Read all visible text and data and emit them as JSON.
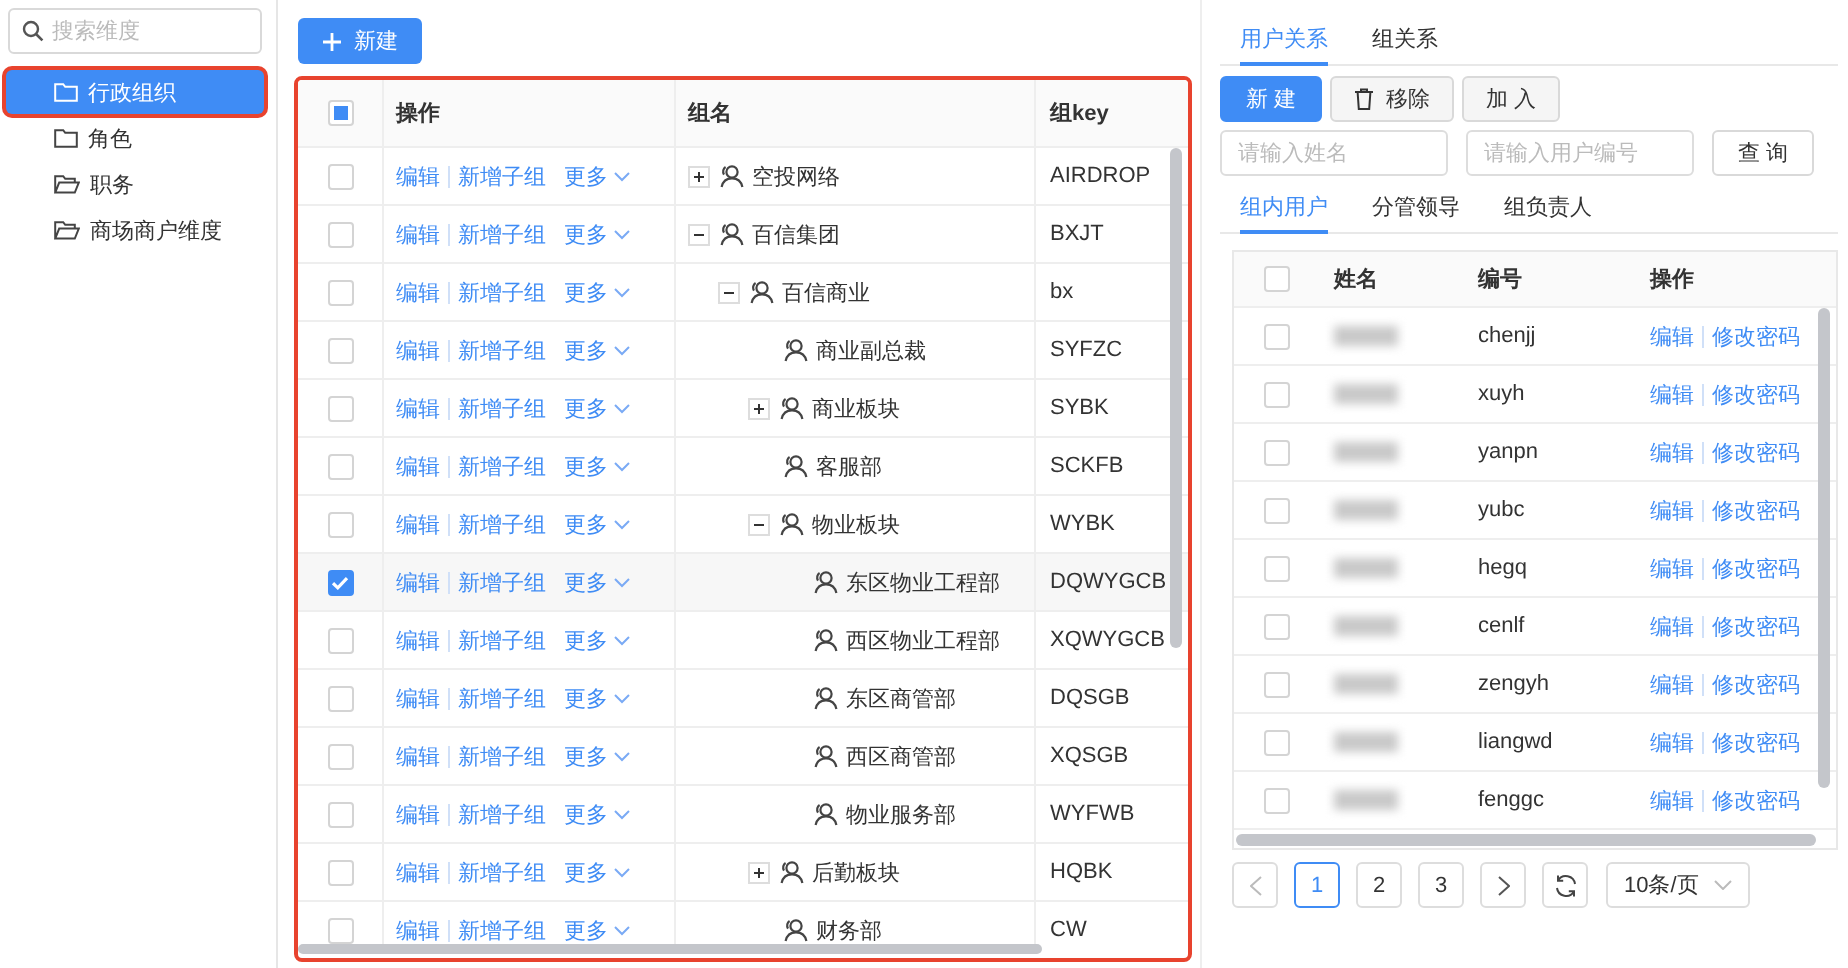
{
  "sidebar": {
    "search": {
      "placeholder": "搜索维度"
    },
    "items": [
      {
        "label": "行政组织",
        "kind": "folder",
        "selected": true,
        "highlighted": true
      },
      {
        "label": "角色",
        "kind": "folder",
        "selected": false,
        "highlighted": false
      },
      {
        "label": "职务",
        "kind": "folder-open",
        "selected": false,
        "highlighted": false
      },
      {
        "label": "商场商户维度",
        "kind": "folder-open",
        "selected": false,
        "highlighted": false
      }
    ]
  },
  "toolbar": {
    "new_button": "新建"
  },
  "group_table": {
    "highlighted": true,
    "select_all": {
      "checked": false,
      "indeterminate": true
    },
    "columns": [
      "操作",
      "组名",
      "组key"
    ],
    "rows": [
      {
        "checked": false,
        "actions": [
          "编辑",
          "新增子组",
          "更多"
        ],
        "name": "空投网络",
        "key": "AIRDROP",
        "expanded": false
      },
      {
        "checked": false,
        "actions": [
          "编辑",
          "新增子组",
          "更多"
        ],
        "name": "百信集团",
        "key": "BXJT",
        "expanded": true,
        "children": [
          {
            "checked": false,
            "actions": [
              "编辑",
              "新增子组",
              "更多"
            ],
            "name": "百信商业",
            "key": "bx",
            "expanded": true,
            "children": [
              {
                "checked": false,
                "actions": [
                  "编辑",
                  "新增子组",
                  "更多"
                ],
                "name": "商业副总裁",
                "key": "SYFZC"
              },
              {
                "checked": false,
                "actions": [
                  "编辑",
                  "新增子组",
                  "更多"
                ],
                "name": "商业板块",
                "key": "SYBK",
                "expanded": false
              },
              {
                "checked": false,
                "actions": [
                  "编辑",
                  "新增子组",
                  "更多"
                ],
                "name": "客服部",
                "key": "SCKFB"
              },
              {
                "checked": false,
                "actions": [
                  "编辑",
                  "新增子组",
                  "更多"
                ],
                "name": "物业板块",
                "key": "WYBK",
                "expanded": true,
                "children": [
                  {
                    "checked": true,
                    "actions": [
                      "编辑",
                      "新增子组",
                      "更多"
                    ],
                    "name": "东区物业工程部",
                    "key": "DQWYGCB"
                  },
                  {
                    "checked": false,
                    "actions": [
                      "编辑",
                      "新增子组",
                      "更多"
                    ],
                    "name": "西区物业工程部",
                    "key": "XQWYGCB"
                  },
                  {
                    "checked": false,
                    "actions": [
                      "编辑",
                      "新增子组",
                      "更多"
                    ],
                    "name": "东区商管部",
                    "key": "DQSGB"
                  },
                  {
                    "checked": false,
                    "actions": [
                      "编辑",
                      "新增子组",
                      "更多"
                    ],
                    "name": "西区商管部",
                    "key": "XQSGB"
                  },
                  {
                    "checked": false,
                    "actions": [
                      "编辑",
                      "新增子组",
                      "更多"
                    ],
                    "name": "物业服务部",
                    "key": "WYFWB"
                  }
                ]
              },
              {
                "checked": false,
                "actions": [
                  "编辑",
                  "新增子组",
                  "更多"
                ],
                "name": "后勤板块",
                "key": "HQBK",
                "expanded": false
              },
              {
                "checked": false,
                "actions": [
                  "编辑",
                  "新增子组",
                  "更多"
                ],
                "name": "财务部",
                "key": "CW"
              }
            ]
          }
        ]
      }
    ]
  },
  "relations": {
    "tabs": [
      {
        "label": "用户关系",
        "selected": true
      },
      {
        "label": "组关系",
        "selected": false
      }
    ],
    "buttons": [
      {
        "label": "新 建",
        "kind": "primary"
      },
      {
        "label": "移除",
        "kind": "delete"
      },
      {
        "label": "加 入",
        "kind": "default"
      }
    ],
    "filters": [
      {
        "placeholder": "请输入姓名"
      },
      {
        "placeholder": "请输入用户编号"
      }
    ],
    "query_button": "查 询",
    "subtabs": [
      {
        "label": "组内用户",
        "selected": true
      },
      {
        "label": "分管领导",
        "selected": false
      },
      {
        "label": "组负责人",
        "selected": false
      }
    ],
    "user_table": {
      "select_all": {
        "checked": false
      },
      "columns": [
        "姓名",
        "编号",
        "操作"
      ],
      "rows": [
        {
          "checked": false,
          "id": "chenjj",
          "actions": [
            "编辑",
            "修改密码"
          ]
        },
        {
          "checked": false,
          "id": "xuyh",
          "actions": [
            "编辑",
            "修改密码"
          ]
        },
        {
          "checked": false,
          "id": "yanpn",
          "actions": [
            "编辑",
            "修改密码"
          ]
        },
        {
          "checked": false,
          "id": "yubc",
          "actions": [
            "编辑",
            "修改密码"
          ]
        },
        {
          "checked": false,
          "id": "hegq",
          "actions": [
            "编辑",
            "修改密码"
          ]
        },
        {
          "checked": false,
          "id": "cenlf",
          "actions": [
            "编辑",
            "修改密码"
          ]
        },
        {
          "checked": false,
          "id": "zengyh",
          "actions": [
            "编辑",
            "修改密码"
          ]
        },
        {
          "checked": false,
          "id": "liangwd",
          "actions": [
            "编辑",
            "修改密码"
          ]
        },
        {
          "checked": false,
          "id": "fenggc",
          "actions": [
            "编辑",
            "修改密码"
          ]
        }
      ]
    },
    "pagination": {
      "pages": [
        {
          "label": "1",
          "selected": true
        },
        {
          "label": "2",
          "selected": false
        },
        {
          "label": "3",
          "selected": false
        }
      ],
      "page_size": "10条/页"
    }
  }
}
